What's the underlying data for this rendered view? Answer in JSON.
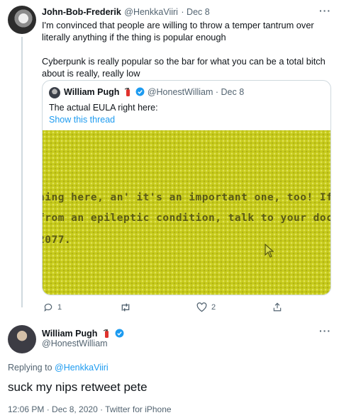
{
  "top_tweet": {
    "name": "John-Bob-Frederik",
    "handle": "@HenkkaViiri",
    "date": "· Dec 8",
    "more": "···",
    "text": "I'm convinced that people are willing to throw a temper tantrum over literally anything if the thing is popular enough\n\nCyberpunk is really popular so the bar for what you can be a total bitch about is really, really low",
    "quote": {
      "name": "William Pugh",
      "handle": "@HonestWilliam",
      "date": "· Dec 8",
      "text": "The actual EULA right here:",
      "link": "Show this thread",
      "image_text": {
        "line1": "hing here, an' it's an important one, too! If you or someo",
        "line2": " from an epileptic condition, talk to your doctor before ",
        "line3": "2077."
      }
    },
    "actions": {
      "reply_count": "1",
      "retweet_count": "",
      "like_count": "2"
    }
  },
  "main_tweet": {
    "name": "William Pugh",
    "handle": "@HonestWilliam",
    "more": "···",
    "replying_label": "Replying to ",
    "replying_to": "@HenkkaViiri",
    "text": "suck my nips retweet pete",
    "meta": "12:06 PM · Dec 8, 2020 · Twitter for iPhone"
  },
  "colors": {
    "accent": "#1d9bf0",
    "secondary_text": "#536471",
    "image_bg": "#c7cb1c"
  }
}
